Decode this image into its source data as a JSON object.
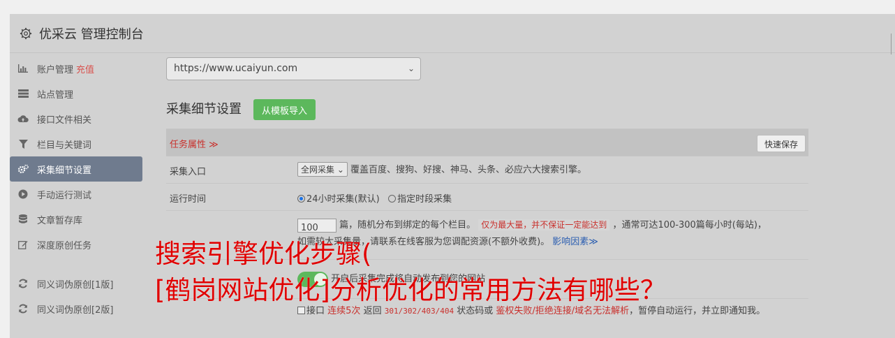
{
  "header": {
    "title": "优采云 管理控制台",
    "icon": "gear-icon"
  },
  "sidebar": {
    "items": [
      {
        "label": "账户管理",
        "badge": "充值",
        "icon": "bar-chart-icon",
        "active": false
      },
      {
        "label": "站点管理",
        "icon": "server-icon",
        "active": false
      },
      {
        "label": "接口文件相关",
        "icon": "cloud-upload-icon",
        "active": false
      },
      {
        "label": "栏目与关键词",
        "icon": "filter-icon",
        "active": false
      },
      {
        "label": "采集细节设置",
        "icon": "cogs-icon",
        "active": true
      },
      {
        "label": "手动运行测试",
        "icon": "play-icon",
        "active": false
      },
      {
        "label": "文章暂存库",
        "icon": "database-icon",
        "active": false
      },
      {
        "label": "深度原创任务",
        "icon": "edit-icon",
        "active": false
      },
      {
        "label": "同义词伪原创[1版]",
        "icon": "refresh-icon",
        "active": false
      },
      {
        "label": "同义词伪原创[2版]",
        "icon": "refresh-icon",
        "active": false
      }
    ]
  },
  "main": {
    "site_select": "https://www.ucaiyun.com",
    "section_title": "采集细节设置",
    "import_button": "从模板导入",
    "task_attr": "任务属性 ≫",
    "quick_save": "快速保存",
    "rows": {
      "entry": {
        "label": "采集入口",
        "select": "全网采集",
        "text": "覆盖百度、搜狗、好搜、神马、头条、必应六大搜索引擎。"
      },
      "runtime": {
        "label": "运行时间",
        "opt1": "24小时采集(默认)",
        "opt2": "指定时段采集"
      },
      "amount": {
        "value": "100",
        "text1": "篇，随机分布到绑定的每个栏目。",
        "tag": "仅为最大量，并不保证一定能达到",
        "text2": "，通常可达100-300篇每小时(每站)，",
        "text3": "如需较大采集量，请联系在线客服为您调配资源(不额外收费)。",
        "link": "影响因素≫"
      },
      "auto_run": {
        "text": "开启后采集完成将自动发布到您的网站"
      },
      "pause": {
        "t1": "接口",
        "t2": "连续5次",
        "t3": "返回",
        "codes": "301/302/403/404",
        "t4": "状态码或",
        "t5": "鉴权失败/拒绝连接/域名无法解析",
        "t6": "，暂停自动运行，并立即通知我。"
      }
    }
  },
  "overlay": {
    "line1": "搜索引擎优化步骤(",
    "line2": "[鹤岗网站优化]分析优化的常用方法有哪些？"
  },
  "colors": {
    "active_item": "#6f7b8e",
    "accent_green": "#5cb85c",
    "accent_red": "#d9534f",
    "overlay_red": "#e00000"
  }
}
